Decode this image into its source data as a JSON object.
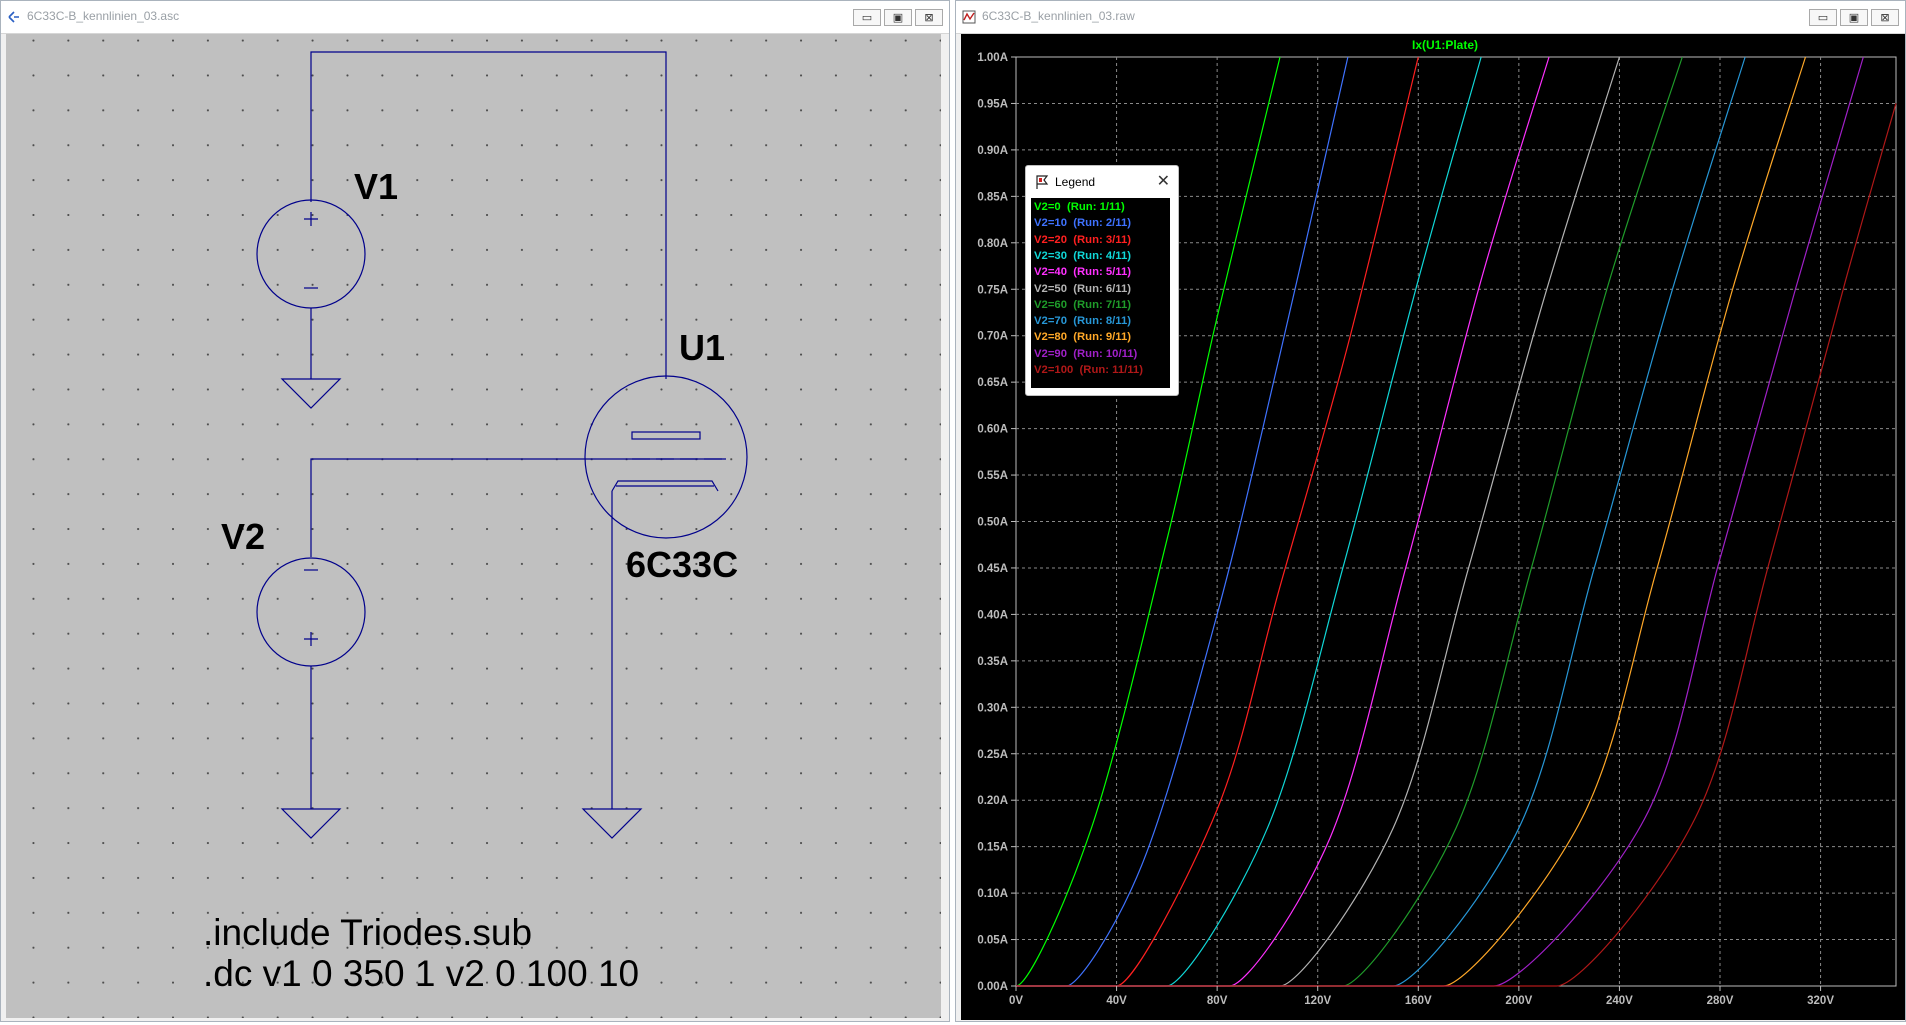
{
  "left_window": {
    "title": "6C33C-B_kennlinien_03.asc",
    "labels": {
      "v1": "V1",
      "v2": "V2",
      "u1": "U1",
      "u1_model": "6C33C",
      "directive_1": ".include Triodes.sub",
      "directive_2": ".dc v1 0 350 1 v2 0 100 10"
    },
    "source_plus": "+",
    "source_minus": "−"
  },
  "right_window": {
    "title": "6C33C-B_kennlinien_03.raw",
    "plot_title": "Ix(U1:Plate)"
  },
  "window_buttons": {
    "minimize": "▭",
    "maximize": "▣",
    "close": "⊠"
  },
  "legend": {
    "title": "Legend",
    "close": "✕",
    "entries": [
      {
        "label": "V2=0",
        "run": "(Run: 1/11)"
      },
      {
        "label": "V2=10",
        "run": "(Run: 2/11)"
      },
      {
        "label": "V2=20",
        "run": "(Run: 3/11)"
      },
      {
        "label": "V2=30",
        "run": "(Run: 4/11)"
      },
      {
        "label": "V2=40",
        "run": "(Run: 5/11)"
      },
      {
        "label": "V2=50",
        "run": "(Run: 6/11)"
      },
      {
        "label": "V2=60",
        "run": "(Run: 7/11)"
      },
      {
        "label": "V2=70",
        "run": "(Run: 8/11)"
      },
      {
        "label": "V2=80",
        "run": "(Run: 9/11)"
      },
      {
        "label": "V2=90",
        "run": "(Run: 10/11)"
      },
      {
        "label": "V2=100",
        "run": "(Run: 11/11)"
      }
    ]
  },
  "chart_data": {
    "type": "line",
    "title": "Ix(U1:Plate)",
    "xlim": [
      0,
      350
    ],
    "ylim": [
      0,
      1.0
    ],
    "x_ticks": [
      "0V",
      "40V",
      "80V",
      "120V",
      "160V",
      "200V",
      "240V",
      "280V",
      "320V"
    ],
    "x_tick_values": [
      0,
      40,
      80,
      120,
      160,
      200,
      240,
      280,
      320
    ],
    "y_ticks": [
      "0.00A",
      "0.05A",
      "0.10A",
      "0.15A",
      "0.20A",
      "0.25A",
      "0.30A",
      "0.35A",
      "0.40A",
      "0.45A",
      "0.50A",
      "0.55A",
      "0.60A",
      "0.65A",
      "0.70A",
      "0.75A",
      "0.80A",
      "0.85A",
      "0.90A",
      "0.95A",
      "1.00A"
    ],
    "y_tick_values": [
      0,
      0.05,
      0.1,
      0.15,
      0.2,
      0.25,
      0.3,
      0.35,
      0.4,
      0.45,
      0.5,
      0.55,
      0.6,
      0.65,
      0.7,
      0.75,
      0.8,
      0.85,
      0.9,
      0.95,
      1.0
    ],
    "grid": true,
    "series": [
      {
        "name": "V2=0",
        "color": "#00ff00",
        "x": [
          0,
          30,
          60,
          80,
          105
        ],
        "y": [
          0,
          0.17,
          0.48,
          0.72,
          1.0
        ]
      },
      {
        "name": "V2=10",
        "color": "#3f72ff",
        "x": [
          20,
          50,
          80,
          105,
          132
        ],
        "y": [
          0,
          0.13,
          0.4,
          0.68,
          1.0
        ]
      },
      {
        "name": "V2=20",
        "color": "#ff2020",
        "x": [
          40,
          80,
          105,
          132,
          160
        ],
        "y": [
          0,
          0.19,
          0.43,
          0.69,
          1.0
        ]
      },
      {
        "name": "V2=30",
        "color": "#10d7d7",
        "x": [
          60,
          100,
          130,
          160,
          185
        ],
        "y": [
          0,
          0.17,
          0.45,
          0.76,
          1.0
        ]
      },
      {
        "name": "V2=40",
        "color": "#ff30ff",
        "x": [
          85,
          125,
          155,
          185,
          212
        ],
        "y": [
          0,
          0.16,
          0.45,
          0.76,
          1.0
        ]
      },
      {
        "name": "V2=50",
        "color": "#b4b4b4",
        "x": [
          105,
          150,
          180,
          210,
          240
        ],
        "y": [
          0,
          0.17,
          0.45,
          0.74,
          1.0
        ]
      },
      {
        "name": "V2=60",
        "color": "#1f9c2a",
        "x": [
          130,
          175,
          205,
          235,
          265
        ],
        "y": [
          0,
          0.17,
          0.45,
          0.75,
          1.0
        ]
      },
      {
        "name": "V2=70",
        "color": "#2797d7",
        "x": [
          150,
          200,
          230,
          260,
          290
        ],
        "y": [
          0,
          0.17,
          0.45,
          0.74,
          1.0
        ]
      },
      {
        "name": "V2=80",
        "color": "#ffa828",
        "x": [
          170,
          225,
          255,
          285,
          314
        ],
        "y": [
          0,
          0.18,
          0.45,
          0.75,
          1.0
        ]
      },
      {
        "name": "V2=90",
        "color": "#a020c8",
        "x": [
          190,
          250,
          280,
          310,
          337
        ],
        "y": [
          0,
          0.18,
          0.46,
          0.75,
          1.0
        ]
      },
      {
        "name": "V2=100",
        "color": "#b01818",
        "x": [
          215,
          270,
          300,
          330,
          350
        ],
        "y": [
          0,
          0.18,
          0.46,
          0.76,
          0.95
        ]
      }
    ]
  }
}
